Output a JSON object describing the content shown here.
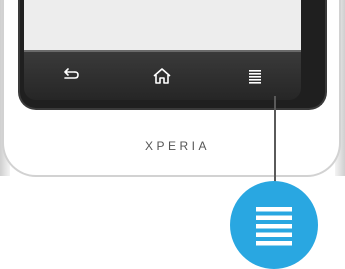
{
  "device": {
    "brand_label": "XPERIA"
  },
  "navigation_keys": [
    {
      "id": "back",
      "icon": "back-arrow-icon"
    },
    {
      "id": "home",
      "icon": "home-icon"
    },
    {
      "id": "menu",
      "icon": "menu-icon"
    }
  ],
  "callout": {
    "target": "menu",
    "icon": "menu-icon",
    "color": "#29a7e1"
  },
  "colors": {
    "panel": "#1f1f1f",
    "nav_bar": "#2e2e2e",
    "screen": "#ededed",
    "key_glyph": "#ffffff",
    "brand_text": "#555555"
  }
}
